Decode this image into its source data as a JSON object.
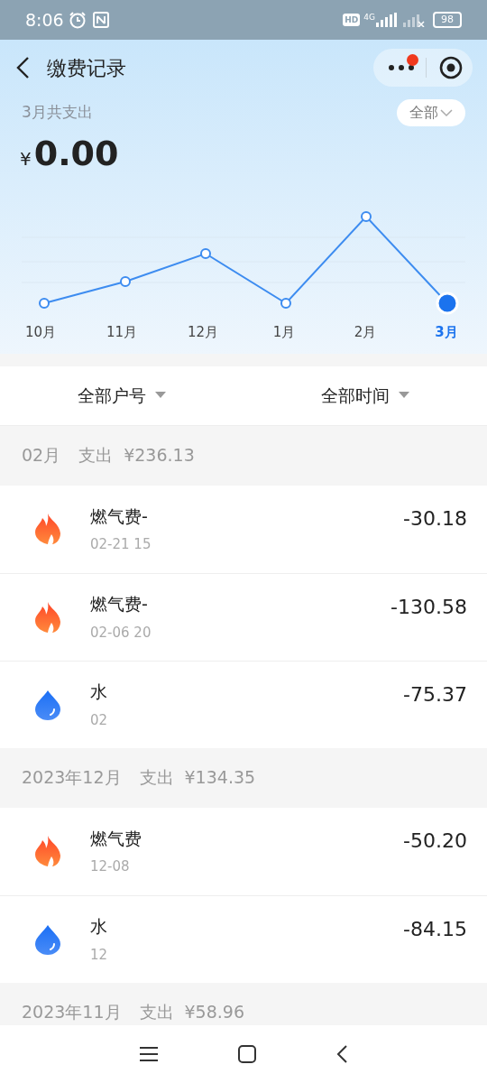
{
  "status_bar": {
    "time": "8:06",
    "network": "4G",
    "hd": "HD",
    "battery": "98"
  },
  "header": {
    "title": "缴费记录",
    "has_notification": true
  },
  "summary": {
    "label": "3月共支出",
    "currency": "¥",
    "amount": "0.00",
    "filter": "全部"
  },
  "months": [
    {
      "label": "10月",
      "selected": false
    },
    {
      "label": "11月",
      "selected": false
    },
    {
      "label": "12月",
      "selected": false
    },
    {
      "label": "1月",
      "selected": false
    },
    {
      "label": "2月",
      "selected": false
    },
    {
      "label": "3月",
      "selected": true
    }
  ],
  "filters": [
    "全部户号",
    "全部时间"
  ],
  "groups": [
    {
      "month": "02月",
      "label": "支出",
      "total": "¥236.13",
      "records": [
        {
          "kind": "gas",
          "name": "燃气费-",
          "time": "02-21 15",
          "amount": "-30.18"
        },
        {
          "kind": "gas",
          "name": "燃气费-",
          "time": "02-06 20",
          "amount": "-130.58"
        },
        {
          "kind": "water",
          "name": "水",
          "time": "02",
          "amount": "-75.37"
        }
      ]
    },
    {
      "month": "2023年12月",
      "label": "支出",
      "total": "¥134.35",
      "records": [
        {
          "kind": "gas",
          "name": "燃气费",
          "time": "12-08",
          "amount": "-50.20"
        },
        {
          "kind": "water",
          "name": "水",
          "time": "12",
          "amount": "-84.15"
        }
      ]
    },
    {
      "month": "2023年11月",
      "label": "支出",
      "total": "¥58.96"
    }
  ]
}
